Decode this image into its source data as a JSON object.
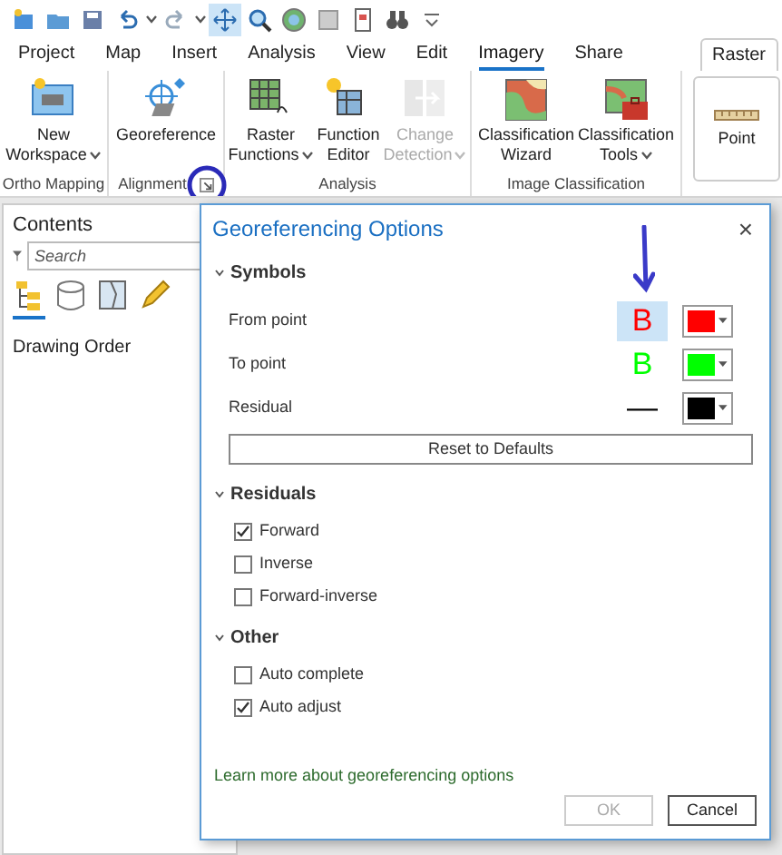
{
  "tabs": [
    {
      "label": "Project",
      "selected": false,
      "kind": "tab"
    },
    {
      "label": "Map",
      "selected": false,
      "kind": "tab"
    },
    {
      "label": "Insert",
      "selected": false,
      "kind": "tab"
    },
    {
      "label": "Analysis",
      "selected": false,
      "kind": "tab"
    },
    {
      "label": "View",
      "selected": false,
      "kind": "tab"
    },
    {
      "label": "Edit",
      "selected": false,
      "kind": "tab"
    },
    {
      "label": "Imagery",
      "selected": true,
      "kind": "tab"
    },
    {
      "label": "Share",
      "selected": false,
      "kind": "tab"
    },
    {
      "label": "Raster",
      "selected": false,
      "kind": "contextual"
    }
  ],
  "ribbon": {
    "groups": [
      {
        "label": "Ortho Mapping",
        "launcher": false,
        "buttons": [
          {
            "lines": [
              "New",
              "Workspace"
            ],
            "dropdown": true,
            "disabled": false
          }
        ]
      },
      {
        "label": "Alignment",
        "launcher": true,
        "buttons": [
          {
            "lines": [
              "Georeference"
            ],
            "dropdown": false,
            "disabled": false
          }
        ]
      },
      {
        "label": "Analysis",
        "launcher": false,
        "buttons": [
          {
            "lines": [
              "Raster",
              "Functions"
            ],
            "dropdown": true,
            "disabled": false
          },
          {
            "lines": [
              "Function",
              "Editor"
            ],
            "dropdown": false,
            "disabled": false
          },
          {
            "lines": [
              "Change",
              "Detection"
            ],
            "dropdown": true,
            "disabled": true
          }
        ]
      },
      {
        "label": "Image Classification",
        "launcher": false,
        "buttons": [
          {
            "lines": [
              "Classification",
              "Wizard"
            ],
            "dropdown": false,
            "disabled": false
          },
          {
            "lines": [
              "Classification",
              "Tools"
            ],
            "dropdown": true,
            "disabled": false
          }
        ]
      }
    ],
    "extra_button": "Point"
  },
  "contents": {
    "title": "Contents",
    "search": {
      "placeholder": "Search"
    },
    "tools": [
      {
        "selected": true
      },
      {
        "selected": false
      },
      {
        "selected": false
      },
      {
        "selected": false
      }
    ],
    "heading": "Drawing Order"
  },
  "dialog": {
    "title": "Georeferencing Options",
    "close": "×",
    "sections": [
      {
        "title": "Symbols",
        "expanded": true,
        "kind": "symbols",
        "rows": [
          {
            "label": "From point",
            "symbol": "B",
            "color": "#ff0000",
            "selected": true
          },
          {
            "label": "To point",
            "symbol": "B",
            "color": "#00ff00",
            "selected": false
          },
          {
            "label": "Residual",
            "symbol": "—",
            "color": "#000000",
            "selected": false
          }
        ],
        "button": "Reset to Defaults"
      },
      {
        "title": "Residuals",
        "expanded": true,
        "kind": "checks",
        "items": [
          {
            "label": "Forward",
            "checked": true
          },
          {
            "label": "Inverse",
            "checked": false
          },
          {
            "label": "Forward-inverse",
            "checked": false
          }
        ]
      },
      {
        "title": "Other",
        "expanded": true,
        "kind": "checks",
        "items": [
          {
            "label": "Auto complete",
            "checked": false
          },
          {
            "label": "Auto adjust",
            "checked": true
          }
        ]
      }
    ],
    "link": "Learn more about georeferencing options",
    "buttons": [
      {
        "label": "OK",
        "disabled": true
      },
      {
        "label": "Cancel",
        "disabled": false
      }
    ]
  }
}
